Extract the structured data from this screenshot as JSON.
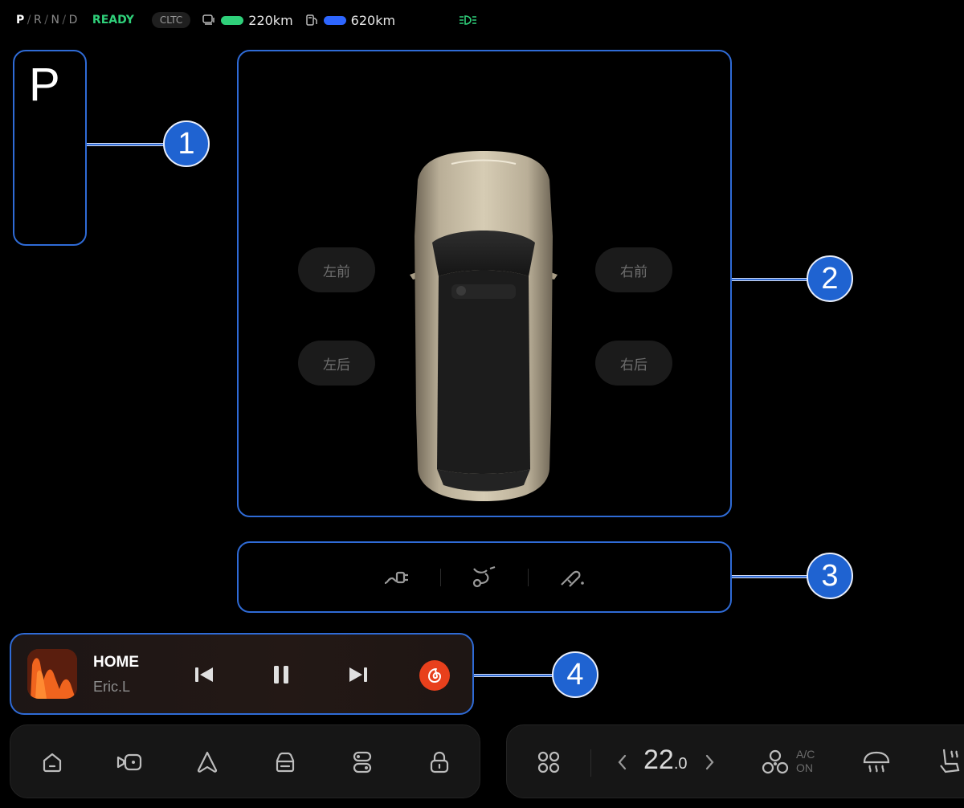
{
  "status_bar": {
    "gears": [
      "P",
      "R",
      "N",
      "D"
    ],
    "active_gear": "P",
    "ready_text": "READY",
    "cltc_label": "CLTC",
    "electric_range": "220km",
    "fuel_range": "620km",
    "colors": {
      "ready": "#2fd07a",
      "electric_battery": "#2fd07a",
      "fuel": "#2e66ff"
    }
  },
  "gear_panel": {
    "current_gear": "P"
  },
  "doors": {
    "front_left": "左前",
    "front_right": "右前",
    "rear_left": "左后",
    "rear_right": "右后"
  },
  "charge_bar": {
    "items": [
      "charge-plug-icon",
      "charge-cable-icon",
      "charge-nozzle-icon"
    ]
  },
  "media": {
    "title": "HOME",
    "artist": "Eric.L",
    "controls": [
      "previous-icon",
      "pause-icon",
      "next-icon"
    ],
    "app_color": "#e8401c"
  },
  "dock": {
    "left_items": [
      "home-icon",
      "camera-icon",
      "navigation-icon",
      "vehicle-icon",
      "controls-icon",
      "lock-icon"
    ],
    "temperature_int": "22",
    "temperature_dec": ".0",
    "ac_line1": "A/C",
    "ac_line2": "ON"
  },
  "callouts": [
    "1",
    "2",
    "3",
    "4"
  ],
  "accent_color": "#2f6bd6"
}
